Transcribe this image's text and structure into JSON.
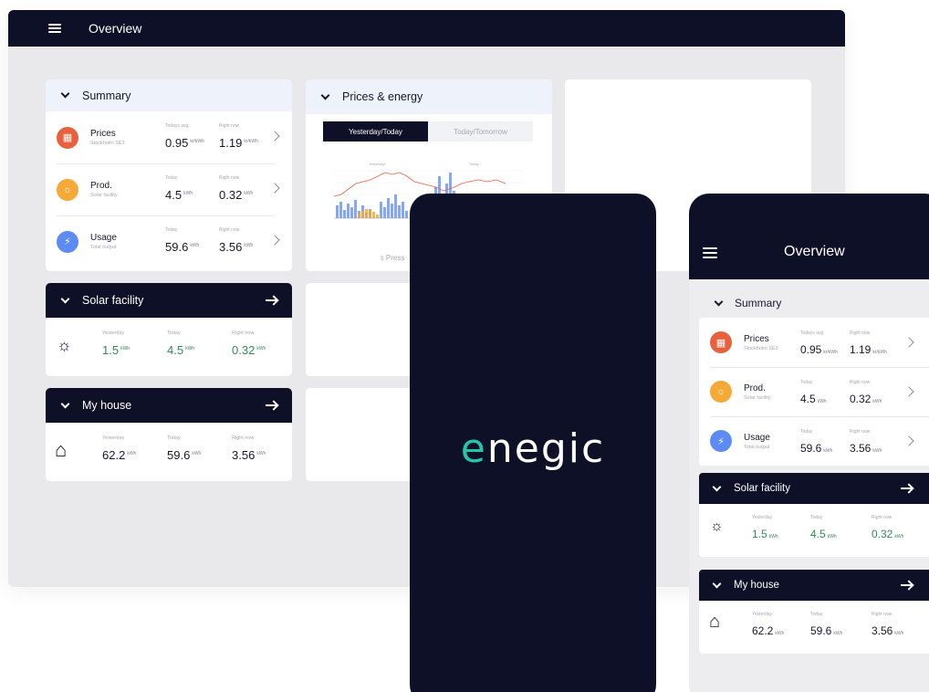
{
  "desktop": {
    "title": "Overview",
    "summary": {
      "title": "Summary",
      "rows": [
        {
          "name": "Prices",
          "sub": "Stockholm SE3",
          "c1": "Todays avg.",
          "v1": "0.95",
          "u1": "kr/kWh",
          "c2": "Right now",
          "v2": "1.19",
          "u2": "kr/kWh",
          "color": "#e9603d"
        },
        {
          "name": "Prod.",
          "sub": "Solar facility",
          "c1": "Today",
          "v1": "4.5",
          "u1": "kWh",
          "c2": "Right now",
          "v2": "0.32",
          "u2": "kWh",
          "color": "#f5a937"
        },
        {
          "name": "Usage",
          "sub": "Total output",
          "c1": "Today",
          "v1": "59.6",
          "u1": "kWh",
          "c2": "Right now",
          "v2": "3.56",
          "u2": "kWh",
          "color": "#5b8bf3"
        }
      ]
    },
    "prices": {
      "title": "Prices & energy",
      "tab_active": "Yesterday/Today",
      "tab_inactive": "Today/Tomorrow",
      "chart_left_label": "Yesterday",
      "chart_right_label": "Today",
      "footer": "Press"
    },
    "solar": {
      "title": "Solar facility",
      "caps": [
        "Yesterday",
        "Today",
        "Right now"
      ],
      "values": [
        "1.5",
        "4.5",
        "0.32"
      ],
      "unit": "kWh"
    },
    "house": {
      "title": "My house",
      "caps": [
        "Yesterday",
        "Today",
        "Right now"
      ],
      "values": [
        "62.2",
        "59.6",
        "3.56"
      ],
      "unit": "kWh"
    }
  },
  "splash": {
    "logo_accent": "e",
    "logo_rest": "negic"
  },
  "mobile": {
    "title": "Overview",
    "summary_title": "Summary",
    "rows": [
      {
        "name": "Prices",
        "sub": "Stockholm SE3",
        "c1": "Todays avg",
        "v1": "0.95",
        "u1": "kr/kWh",
        "c2": "Right now",
        "v2": "1.19",
        "u2": "kr/kWh"
      },
      {
        "name": "Prod.",
        "sub": "Solar facility",
        "c1": "Today",
        "v1": "4.5",
        "u1": "kWh",
        "c2": "Right now",
        "v2": "0.32",
        "u2": "kWh"
      },
      {
        "name": "Usage",
        "sub": "Total output",
        "c1": "Today",
        "v1": "59.6",
        "u1": "kWh",
        "c2": "Right now",
        "v2": "3.56",
        "u2": "kWh"
      }
    ],
    "solar_title": "Solar facility",
    "house_title": "My house"
  }
}
